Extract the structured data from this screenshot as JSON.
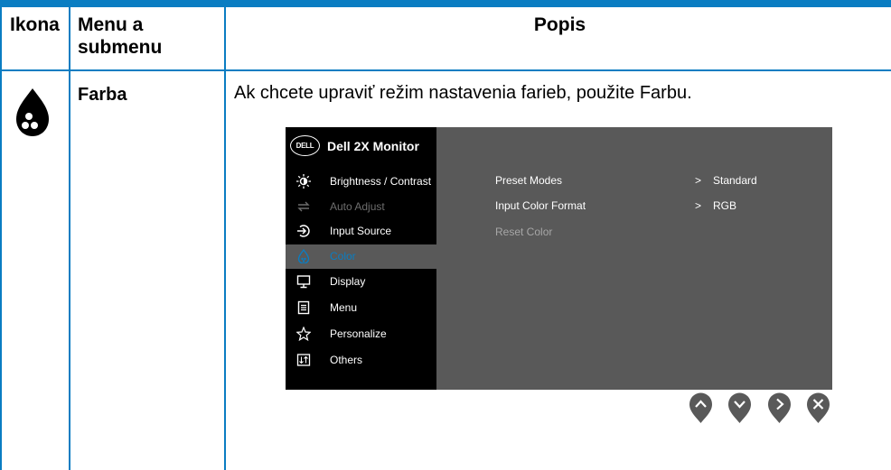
{
  "table": {
    "header": {
      "icon_col": "Ikona",
      "menu_col": "Menu a submenu",
      "desc_col": "Popis"
    },
    "row": {
      "menu_label": "Farba",
      "description": "Ak chcete upraviť režim nastavenia farieb, použite Farbu.",
      "icon": "color-drop-icon"
    }
  },
  "osd": {
    "logo": "DELL",
    "model": "Dell 2X Monitor",
    "menu_items": [
      {
        "label": "Brightness / Contrast",
        "icon": "brightness-icon"
      },
      {
        "label": "Auto Adjust",
        "icon": "auto-adjust-icon"
      },
      {
        "label": "Input Source",
        "icon": "input-source-icon"
      },
      {
        "label": "Color",
        "icon": "color-icon"
      },
      {
        "label": "Display",
        "icon": "display-icon"
      },
      {
        "label": "Menu",
        "icon": "menu-icon"
      },
      {
        "label": "Personalize",
        "icon": "star-icon"
      },
      {
        "label": "Others",
        "icon": "others-icon"
      }
    ],
    "options": [
      {
        "label": "Preset Modes",
        "value": "Standard"
      },
      {
        "label": "Input Color Format",
        "value": "RGB"
      },
      {
        "label": "Reset Color"
      }
    ],
    "value_arrow": ">"
  },
  "buttons": [
    {
      "name": "up",
      "icon": "chevron-up-icon"
    },
    {
      "name": "down",
      "icon": "chevron-down-icon"
    },
    {
      "name": "right",
      "icon": "chevron-right-icon"
    },
    {
      "name": "exit",
      "icon": "close-icon"
    }
  ],
  "colors": {
    "accent": "#0a7dc2",
    "osd_panel": "#595959",
    "osd_bg": "#000000"
  }
}
